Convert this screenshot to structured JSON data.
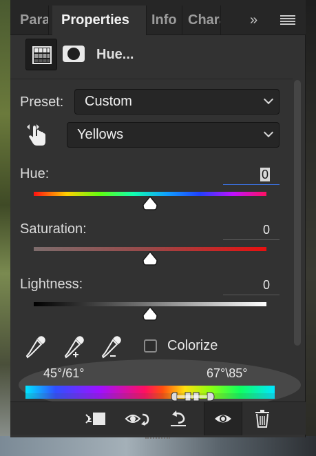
{
  "tabs": [
    {
      "label": "Paragraph"
    },
    {
      "label": "Properties"
    },
    {
      "label": "Info"
    },
    {
      "label": "Character"
    }
  ],
  "tabbar": {
    "overflow_icon": "»",
    "menu_icon": "menu-icon"
  },
  "header": {
    "title": "Hue..."
  },
  "preset": {
    "label": "Preset:",
    "value": "Custom"
  },
  "channel": {
    "value": "Yellows"
  },
  "hue": {
    "label": "Hue:",
    "value": "0",
    "level": 0.5
  },
  "saturation": {
    "label": "Saturation:",
    "value": "0",
    "level": 0.5
  },
  "lightness": {
    "label": "Lightness:",
    "value": "0",
    "level": 0.5
  },
  "colorize": {
    "label": "Colorize",
    "checked": false
  },
  "range": {
    "left": "45°/61°",
    "right": "67°\\85°"
  },
  "colors": {
    "panel": "#323232",
    "field": "#262626",
    "focus": "#3b6ed8"
  }
}
